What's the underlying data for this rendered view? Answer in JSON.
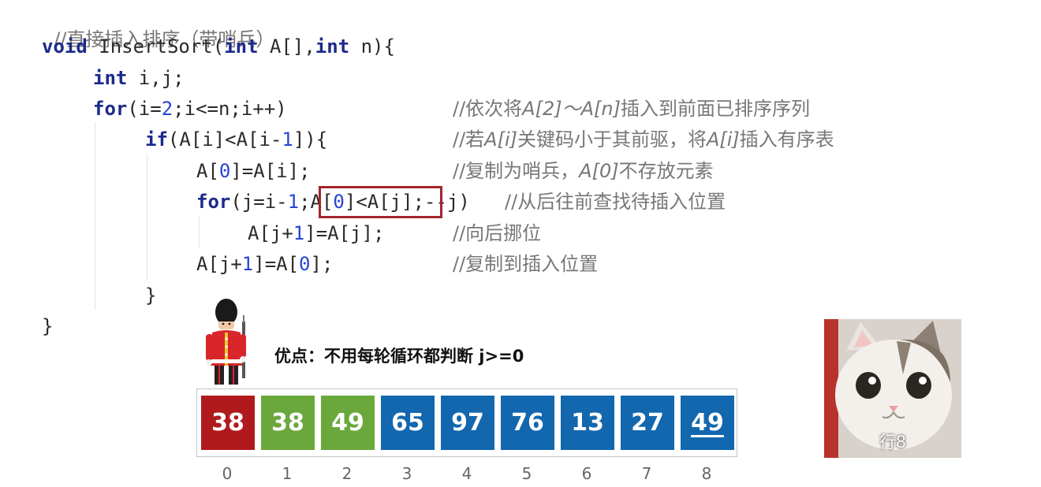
{
  "code": {
    "title_comment": "//直接插入排序（带哨兵）",
    "signature": {
      "kw_void": "void",
      "name": " InsertSort(",
      "kw_int1": "int",
      "arr": " A[],",
      "kw_int2": "int",
      "tail": " n){"
    },
    "decl": {
      "kw": "int",
      "rest": " i,j;"
    },
    "outer_for": {
      "kw": "for",
      "a": "(i=",
      "n": "2",
      "b": ";i<=n;i++)",
      "comment_pre": "//依次将",
      "comment_i1": "A[2]～A[n]",
      "comment_post": "插入到前面已排序序列"
    },
    "if_line": {
      "kw": "if",
      "a": "(A[i]<A[i-",
      "n": "1",
      "b": "]){",
      "comment_pre": "//若",
      "comment_i1": "A[i]",
      "comment_mid": "关键码小于其前驱，将",
      "comment_i2": "A[i]",
      "comment_post": "插入有序表"
    },
    "copy_line": {
      "a": "A[",
      "n": "0",
      "b": "]=A[i];",
      "comment_pre": "//复制为哨兵，",
      "comment_i1": "A[0]",
      "comment_post": "不存放元素"
    },
    "inner_for": {
      "kw": "for",
      "a": "(j=i-",
      "n1": "1",
      "b": ";",
      "c": "A[",
      "n2": "0",
      "d": "]<A[j]",
      "e": ";--j)",
      "comment": "//从后往前查找待插入位置"
    },
    "shift_line": {
      "a": "A[j+",
      "n": "1",
      "b": "]=A[j];",
      "comment": "//向后挪位"
    },
    "place_line": {
      "a": "A[j+",
      "n1": "1",
      "b": "]=A[",
      "n2": "0",
      "c": "];",
      "comment": "//复制到插入位置"
    },
    "close_if": "}",
    "close_fn": "}"
  },
  "advantage_text": "优点：不用每轮循环都判断 j>=0",
  "array": {
    "cells": [
      {
        "value": "38",
        "color": "#b01a1d",
        "index": "0"
      },
      {
        "value": "38",
        "color": "#6aa83c",
        "index": "1"
      },
      {
        "value": "49",
        "color": "#6aa83c",
        "index": "2"
      },
      {
        "value": "65",
        "color": "#1267ae",
        "index": "3"
      },
      {
        "value": "97",
        "color": "#1267ae",
        "index": "4"
      },
      {
        "value": "76",
        "color": "#1267ae",
        "index": "5"
      },
      {
        "value": "13",
        "color": "#1267ae",
        "index": "6"
      },
      {
        "value": "27",
        "color": "#1267ae",
        "index": "7"
      },
      {
        "value": "49",
        "color": "#1267ae",
        "index": "8",
        "underline": true
      }
    ]
  },
  "overlay": {
    "caption": "行8"
  }
}
